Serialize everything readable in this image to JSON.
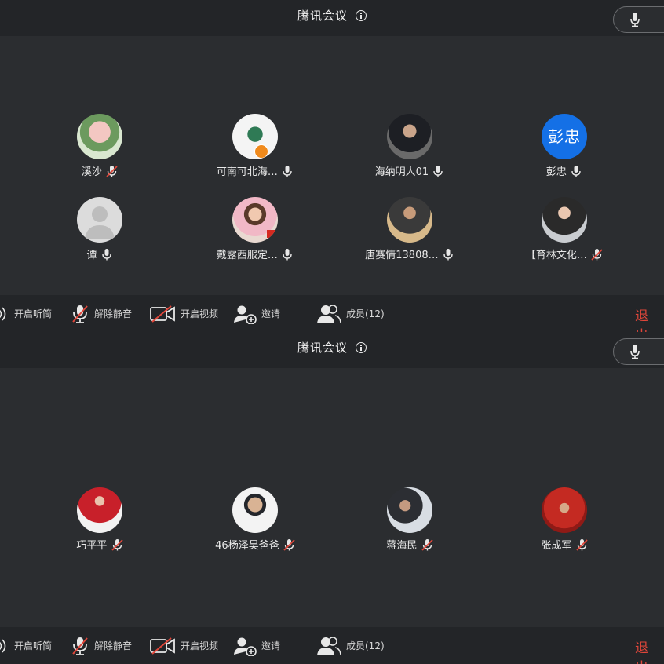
{
  "panels": [
    {
      "title": "腾讯会议",
      "participants": [
        {
          "name": "溪沙",
          "mic": "muted"
        },
        {
          "name": "可南可北海…",
          "mic": "on"
        },
        {
          "name": "海纳明人01",
          "mic": "on"
        },
        {
          "name": "彭忠",
          "mic": "on",
          "avatar_text": "彭忠"
        },
        {
          "name": "谭",
          "mic": "on"
        },
        {
          "name": "戴露西服定…",
          "mic": "on"
        },
        {
          "name": "唐赛情13808…",
          "mic": "on"
        },
        {
          "name": "【育林文化…",
          "mic": "muted"
        }
      ],
      "toolbar": {
        "speaker": "开启听筒",
        "unmute": "解除静音",
        "video": "开启视频",
        "invite": "邀请",
        "members": "成员(12)",
        "exit": "退出"
      }
    },
    {
      "title": "腾讯会议",
      "participants": [
        {
          "name": "巧平平",
          "mic": "muted"
        },
        {
          "name": "46杨泽昊爸爸",
          "mic": "muted"
        },
        {
          "name": "蒋海民",
          "mic": "muted"
        },
        {
          "name": "张成军",
          "mic": "muted"
        }
      ],
      "toolbar": {
        "speaker": "开启听筒",
        "unmute": "解除静音",
        "video": "开启视频",
        "invite": "邀请",
        "members": "成员(12)",
        "exit": "退出"
      }
    }
  ],
  "colors": {
    "accent_blue": "#1470e6",
    "exit_red": "#e0463a",
    "muted_red": "#e0463a"
  }
}
